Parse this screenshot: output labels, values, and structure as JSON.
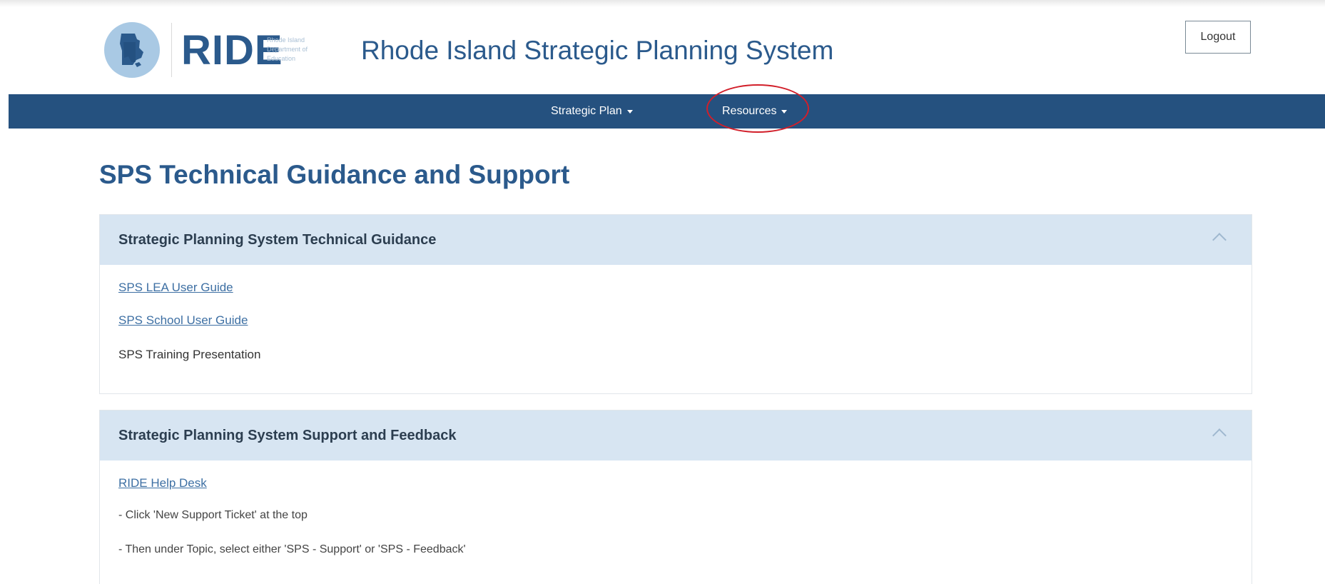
{
  "header": {
    "logo_text": "RIDE",
    "logo_subtext": "Rhode Island Department of Education",
    "site_title": "Rhode Island Strategic Planning System",
    "logout_label": "Logout"
  },
  "nav": {
    "items": [
      {
        "label": "Strategic Plan"
      },
      {
        "label": "Resources"
      }
    ]
  },
  "main": {
    "page_title": "SPS Technical Guidance and Support",
    "panels": [
      {
        "title": "Strategic Planning System Technical Guidance",
        "links": [
          {
            "label": "SPS LEA User Guide"
          },
          {
            "label": "SPS School User Guide"
          }
        ],
        "text": "SPS Training Presentation"
      },
      {
        "title": "Strategic Planning System Support and Feedback",
        "links": [
          {
            "label": "RIDE Help Desk"
          }
        ],
        "lines": [
          " - Click 'New Support Ticket' at the top",
          " - Then under Topic, select either 'SPS - Support' or 'SPS - Feedback'"
        ]
      }
    ]
  },
  "colors": {
    "brand_blue": "#2b5a8c",
    "nav_bg": "#25517f",
    "panel_header_bg": "#d7e5f2",
    "highlight_red": "#d21f2a"
  }
}
